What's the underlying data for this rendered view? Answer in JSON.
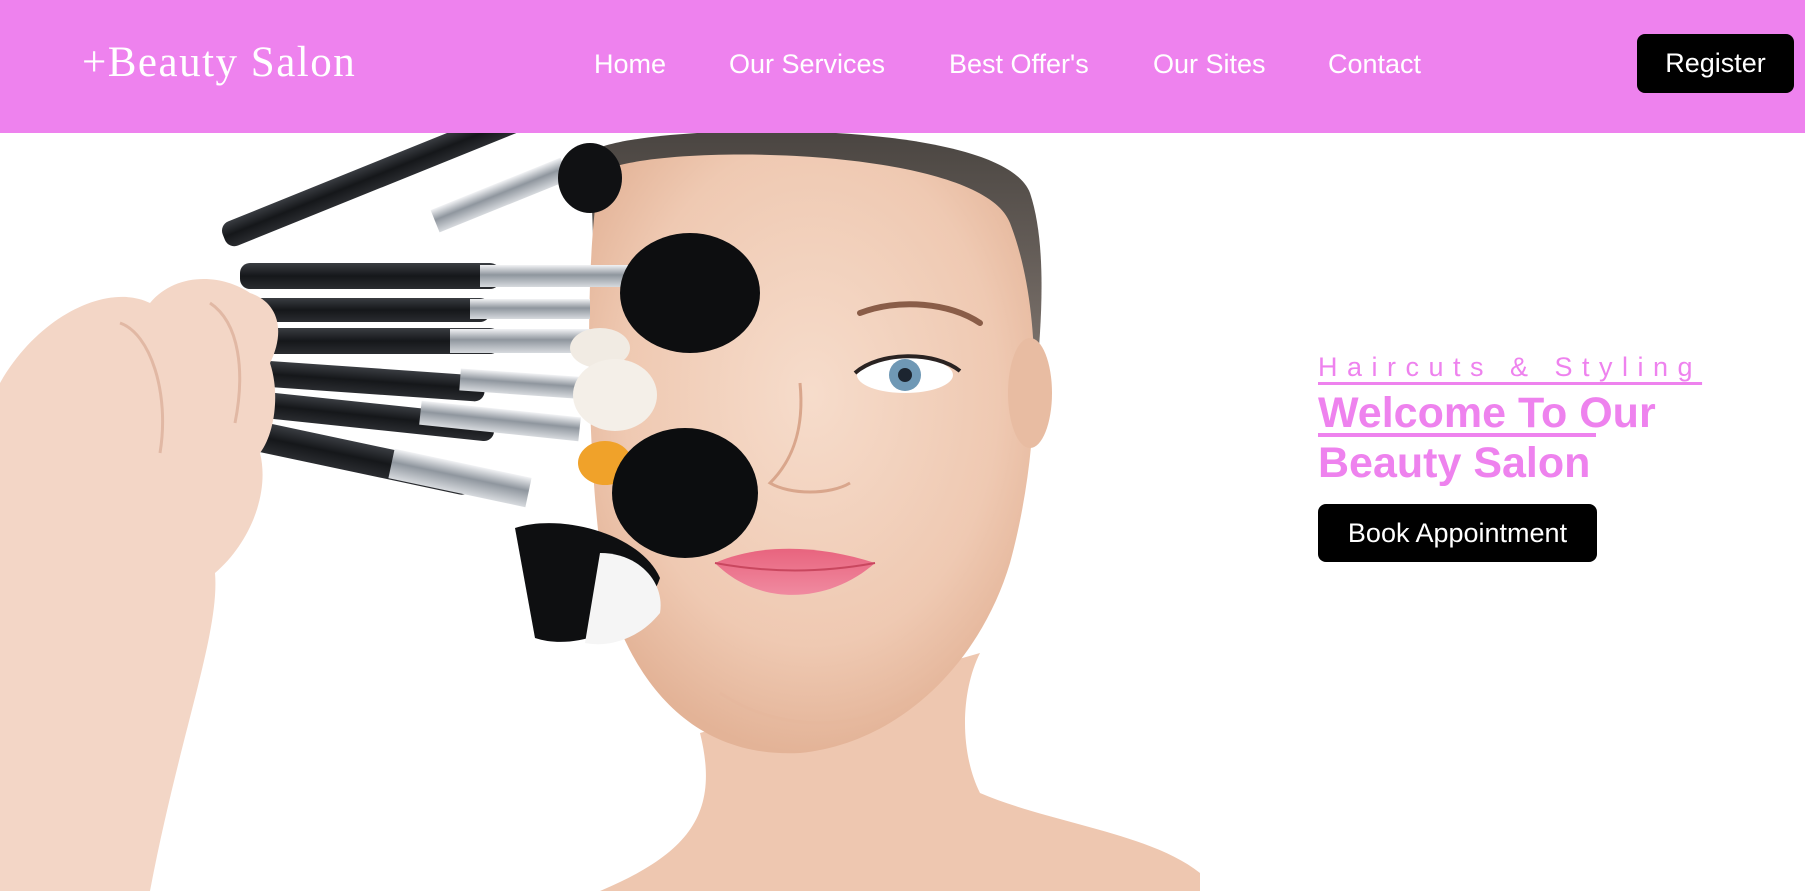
{
  "header": {
    "logo": "+Beauty Salon",
    "nav": [
      {
        "label": "Home"
      },
      {
        "label": "Our Services"
      },
      {
        "label": "Best Offer's"
      },
      {
        "label": "Our Sites"
      },
      {
        "label": "Contact"
      }
    ],
    "register_label": "Register"
  },
  "hero": {
    "tagline": "Haircuts & Styling",
    "welcome_line1": "Welcome To Our",
    "welcome_line2": "Beauty Salon",
    "book_label": "Book Appointment",
    "image_icon": "woman-with-makeup-brushes"
  },
  "colors": {
    "header_bg": "#ee82ee",
    "accent": "#ee82ee",
    "button_bg": "#000000",
    "button_text": "#ffffff",
    "page_bg": "#ffffff"
  }
}
